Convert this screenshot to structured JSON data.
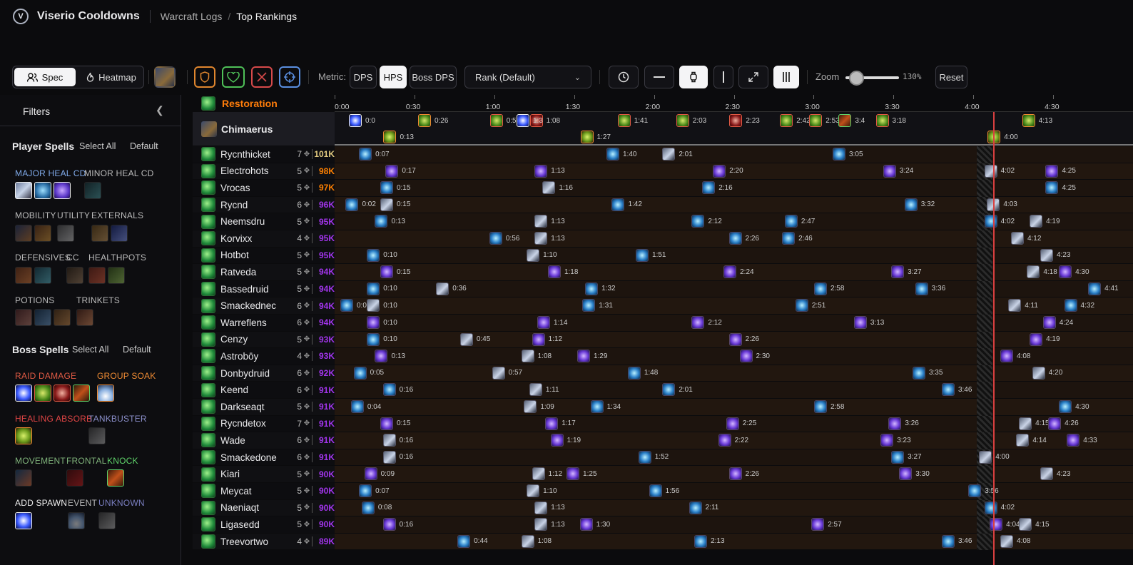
{
  "header": {
    "app_title": "Viserio Cooldowns",
    "logo_letter": "V",
    "crumbs": [
      "Warcraft Logs",
      "Top Rankings"
    ],
    "separator": "/"
  },
  "toolbar": {
    "spec_label": "Spec",
    "heatmap_label": "Heatmap",
    "metric_label": "Metric:",
    "metric_options": [
      "DPS",
      "HPS",
      "Boss DPS"
    ],
    "metric_selected": "HPS",
    "rank_select": "Rank (Default)",
    "zoom_label": "Zoom",
    "zoom_value": "130%",
    "zoom_fraction": 0.2,
    "reset_label": "Reset"
  },
  "sidebar": {
    "filters_title": "Filters",
    "player_spells": "Player Spells",
    "select_all": "Select All",
    "default": "Default",
    "boss_spells": "Boss Spells",
    "player_categories": [
      "MAJOR HEAL CD",
      "MINOR HEAL CD",
      "MOBILITY",
      "UTILITY",
      "EXTERNALS",
      "DEFENSIVES",
      "CC",
      "HEALTHPOTS",
      "POTIONS",
      "TRINKETS"
    ],
    "boss_categories": [
      "RAID DAMAGE",
      "GROUP SOAK",
      "HEALING ABSORB",
      "TANKBUSTER",
      "MOVEMENT",
      "FRONTAL",
      "KNOCK",
      "ADD SPAWN",
      "EVENT",
      "UNKNOWN"
    ],
    "colors": {
      "raid_damage": "#e05a44",
      "group_soak": "#ee8a33",
      "healing_absorb": "#e04545",
      "tankbuster": "#8a8ec9",
      "movement": "#7fb27a",
      "frontal": "#7fb27a",
      "knock": "#5fd36a",
      "add_spawn": "#eeeeee",
      "event": "#bbbbbb",
      "unknown": "#7a7ec0"
    }
  },
  "grid": {
    "spec_header": "Restoration",
    "boss_name": "Chimaerus",
    "time_ticks": [
      "0:00",
      "0:30",
      "1:00",
      "1:30",
      "2:00",
      "2:30",
      "3:00",
      "3:30",
      "4:00",
      "4:30"
    ],
    "boss_events": [
      {
        "t": "0:0",
        "kind": "white"
      },
      {
        "t": "0:26",
        "kind": "soak"
      },
      {
        "t": "0:13",
        "kind": "absorb"
      },
      {
        "t": "0:53",
        "kind": "raid"
      },
      {
        "t": "1:08",
        "kind": "maw"
      },
      {
        "t": "1:3",
        "kind": "white"
      },
      {
        "t": "1:41",
        "kind": "raid"
      },
      {
        "t": "1:27",
        "kind": "absorb"
      },
      {
        "t": "2:03",
        "kind": "raid"
      },
      {
        "t": "2:23",
        "kind": "maw"
      },
      {
        "t": "2:42",
        "kind": "raid"
      },
      {
        "t": "2:53",
        "kind": "raid"
      },
      {
        "t": "3:18",
        "kind": "raid"
      },
      {
        "t": "3:4",
        "kind": "knock"
      },
      {
        "t": "4:13",
        "kind": "soak"
      },
      {
        "t": "4:00",
        "kind": "absorb"
      }
    ],
    "players": [
      {
        "name": "Rycnthicket",
        "count": "7",
        "amount": "101K",
        "color": "#e5cc80",
        "events": [
          [
            "0:07",
            "leaf"
          ],
          [
            "1:40",
            "leaf"
          ],
          [
            "2:01",
            "grey"
          ],
          [
            "3:05",
            "leaf"
          ]
        ]
      },
      {
        "name": "Electrohots",
        "count": "5",
        "amount": "98K",
        "color": "#ff8000",
        "events": [
          [
            "0:17",
            "purple"
          ],
          [
            "1:13",
            "purple"
          ],
          [
            "2:20",
            "purple"
          ],
          [
            "3:24",
            "purple"
          ],
          [
            "4:02",
            "grey"
          ],
          [
            "4:25",
            "purple"
          ]
        ]
      },
      {
        "name": "Vrocas",
        "count": "5",
        "amount": "97K",
        "color": "#ff8000",
        "events": [
          [
            "0:15",
            "leaf"
          ],
          [
            "1:16",
            "grey"
          ],
          [
            "2:16",
            "leaf"
          ],
          [
            "4:25",
            "leaf"
          ]
        ]
      },
      {
        "name": "Rycnd",
        "count": "6",
        "amount": "96K",
        "color": "#a335ee",
        "events": [
          [
            "0:02",
            "leaf"
          ],
          [
            "0:15",
            "grey"
          ],
          [
            "1:42",
            "leaf"
          ],
          [
            "3:32",
            "leaf"
          ],
          [
            "4:03",
            "grey"
          ]
        ]
      },
      {
        "name": "Neemsdru",
        "count": "5",
        "amount": "95K",
        "color": "#a335ee",
        "events": [
          [
            "0:13",
            "leaf"
          ],
          [
            "1:13",
            "grey"
          ],
          [
            "2:12",
            "leaf"
          ],
          [
            "2:47",
            "leaf"
          ],
          [
            "4:02",
            "leaf"
          ],
          [
            "4:19",
            "grey"
          ]
        ]
      },
      {
        "name": "Korvixx",
        "count": "4",
        "amount": "95K",
        "color": "#a335ee",
        "events": [
          [
            "0:56",
            "leaf"
          ],
          [
            "1:13",
            "grey"
          ],
          [
            "2:26",
            "leaf"
          ],
          [
            "2:46",
            "leaf"
          ],
          [
            "4:12",
            "grey"
          ]
        ]
      },
      {
        "name": "Hotbot",
        "count": "5",
        "amount": "95K",
        "color": "#a335ee",
        "events": [
          [
            "0:10",
            "leaf"
          ],
          [
            "1:10",
            "grey"
          ],
          [
            "1:51",
            "leaf"
          ],
          [
            "4:23",
            "grey"
          ]
        ]
      },
      {
        "name": "Ratveda",
        "count": "5",
        "amount": "94K",
        "color": "#a335ee",
        "events": [
          [
            "0:15",
            "purple"
          ],
          [
            "1:18",
            "purple"
          ],
          [
            "2:24",
            "purple"
          ],
          [
            "3:27",
            "purple"
          ],
          [
            "4:18",
            "grey"
          ],
          [
            "4:30",
            "purple"
          ]
        ]
      },
      {
        "name": "Bassedruid",
        "count": "5",
        "amount": "94K",
        "color": "#a335ee",
        "events": [
          [
            "0:10",
            "leaf"
          ],
          [
            "0:36",
            "grey"
          ],
          [
            "1:32",
            "leaf"
          ],
          [
            "2:58",
            "leaf"
          ],
          [
            "3:36",
            "leaf"
          ],
          [
            "4:41",
            "leaf"
          ]
        ]
      },
      {
        "name": "Smackednec",
        "count": "6",
        "amount": "94K",
        "color": "#a335ee",
        "events": [
          [
            "0:0",
            "leaf"
          ],
          [
            "0:10",
            "grey"
          ],
          [
            "1:31",
            "leaf"
          ],
          [
            "2:51",
            "leaf"
          ],
          [
            "4:11",
            "grey"
          ],
          [
            "4:32",
            "leaf"
          ]
        ]
      },
      {
        "name": "Warreflens",
        "count": "6",
        "amount": "94K",
        "color": "#a335ee",
        "events": [
          [
            "0:10",
            "purple"
          ],
          [
            "1:14",
            "purple"
          ],
          [
            "2:12",
            "purple"
          ],
          [
            "3:13",
            "purple"
          ],
          [
            "4:24",
            "purple"
          ]
        ]
      },
      {
        "name": "Cenzy",
        "count": "5",
        "amount": "93K",
        "color": "#a335ee",
        "events": [
          [
            "0:10",
            "leaf"
          ],
          [
            "0:45",
            "grey"
          ],
          [
            "1:12",
            "purple"
          ],
          [
            "2:26",
            "purple"
          ],
          [
            "4:19",
            "purple"
          ]
        ]
      },
      {
        "name": "Astrobōy",
        "count": "4",
        "amount": "93K",
        "color": "#a335ee",
        "events": [
          [
            "0:13",
            "purple"
          ],
          [
            "1:08",
            "grey"
          ],
          [
            "1:29",
            "purple"
          ],
          [
            "2:30",
            "purple"
          ],
          [
            "4:08",
            "purple"
          ]
        ]
      },
      {
        "name": "Donbydruid",
        "count": "6",
        "amount": "92K",
        "color": "#a335ee",
        "events": [
          [
            "0:05",
            "leaf"
          ],
          [
            "0:57",
            "grey"
          ],
          [
            "1:48",
            "leaf"
          ],
          [
            "3:35",
            "leaf"
          ],
          [
            "4:20",
            "grey"
          ]
        ]
      },
      {
        "name": "Keend",
        "count": "6",
        "amount": "91K",
        "color": "#a335ee",
        "events": [
          [
            "0:16",
            "leaf"
          ],
          [
            "1:11",
            "grey"
          ],
          [
            "2:01",
            "leaf"
          ],
          [
            "3:46",
            "leaf"
          ]
        ]
      },
      {
        "name": "Darkseaqt",
        "count": "5",
        "amount": "91K",
        "color": "#a335ee",
        "events": [
          [
            "0:04",
            "leaf"
          ],
          [
            "1:09",
            "grey"
          ],
          [
            "1:34",
            "leaf"
          ],
          [
            "2:58",
            "leaf"
          ],
          [
            "4:30",
            "leaf"
          ]
        ]
      },
      {
        "name": "Rycndetox",
        "count": "7",
        "amount": "91K",
        "color": "#a335ee",
        "events": [
          [
            "0:15",
            "purple"
          ],
          [
            "1:17",
            "purple"
          ],
          [
            "2:25",
            "purple"
          ],
          [
            "3:26",
            "purple"
          ],
          [
            "4:15",
            "grey"
          ],
          [
            "4:26",
            "purple"
          ]
        ]
      },
      {
        "name": "Wade",
        "count": "6",
        "amount": "91K",
        "color": "#a335ee",
        "events": [
          [
            "0:16",
            "grey"
          ],
          [
            "1:19",
            "purple"
          ],
          [
            "2:22",
            "purple"
          ],
          [
            "3:23",
            "purple"
          ],
          [
            "4:14",
            "grey"
          ],
          [
            "4:33",
            "purple"
          ]
        ]
      },
      {
        "name": "Smackedone",
        "count": "6",
        "amount": "91K",
        "color": "#a335ee",
        "events": [
          [
            "0:16",
            "grey"
          ],
          [
            "1:52",
            "leaf"
          ],
          [
            "3:27",
            "leaf"
          ],
          [
            "4:00",
            "grey"
          ]
        ]
      },
      {
        "name": "Kiari",
        "count": "5",
        "amount": "90K",
        "color": "#a335ee",
        "events": [
          [
            "0:09",
            "purple"
          ],
          [
            "1:12",
            "grey"
          ],
          [
            "1:25",
            "purple"
          ],
          [
            "2:26",
            "purple"
          ],
          [
            "3:30",
            "purple"
          ],
          [
            "4:23",
            "grey"
          ]
        ]
      },
      {
        "name": "Meycat",
        "count": "5",
        "amount": "90K",
        "color": "#a335ee",
        "events": [
          [
            "0:07",
            "leaf"
          ],
          [
            "1:10",
            "grey"
          ],
          [
            "1:56",
            "leaf"
          ],
          [
            "3:56",
            "leaf"
          ]
        ]
      },
      {
        "name": "Naeniaqt",
        "count": "5",
        "amount": "90K",
        "color": "#a335ee",
        "events": [
          [
            "0:08",
            "leaf"
          ],
          [
            "1:13",
            "grey"
          ],
          [
            "2:11",
            "leaf"
          ],
          [
            "4:02",
            "leaf"
          ]
        ]
      },
      {
        "name": "Ligasedd",
        "count": "5",
        "amount": "90K",
        "color": "#a335ee",
        "events": [
          [
            "0:16",
            "purple"
          ],
          [
            "1:13",
            "grey"
          ],
          [
            "1:30",
            "purple"
          ],
          [
            "2:57",
            "purple"
          ],
          [
            "4:04",
            "purple"
          ],
          [
            "4:15",
            "grey"
          ]
        ]
      },
      {
        "name": "Treevortwo",
        "count": "4",
        "amount": "89K",
        "color": "#a335ee",
        "events": [
          [
            "0:44",
            "leaf"
          ],
          [
            "1:08",
            "grey"
          ],
          [
            "2:13",
            "leaf"
          ],
          [
            "3:46",
            "leaf"
          ],
          [
            "4:08",
            "grey"
          ]
        ]
      }
    ]
  }
}
